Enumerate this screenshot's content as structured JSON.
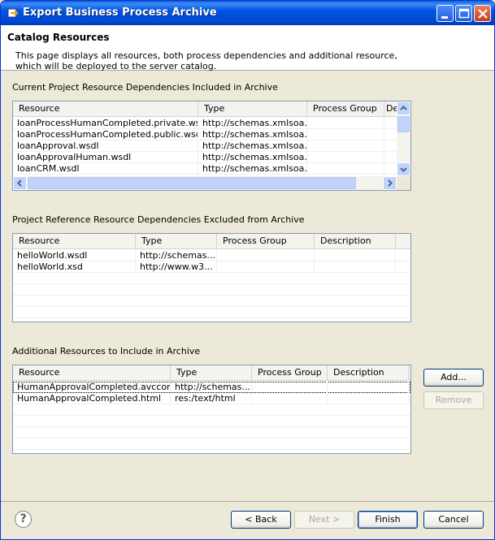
{
  "window": {
    "title": "Export Business Process Archive"
  },
  "header": {
    "title": "Catalog Resources",
    "description": "This page displays all resources, both process dependencies and additional resource, which will be deployed to the server catalog."
  },
  "sections": {
    "included_label": "Current Project Resource Dependencies Included in Archive",
    "excluded_label": "Project Reference Resource Dependencies Excluded from Archive",
    "additional_label": "Additional Resources to Include in Archive"
  },
  "included_table": {
    "columns": [
      "Resource",
      "Type",
      "Process Group",
      "Des"
    ],
    "rows": [
      [
        "loanProcessHumanCompleted.private.wsdl",
        "http://schemas.xmlsoa...",
        "",
        ""
      ],
      [
        "loanProcessHumanCompleted.public.wsdl",
        "http://schemas.xmlsoa...",
        "",
        ""
      ],
      [
        "loanApproval.wsdl",
        "http://schemas.xmlsoa...",
        "",
        ""
      ],
      [
        "loanApprovalHuman.wsdl",
        "http://schemas.xmlsoa...",
        "",
        ""
      ],
      [
        "loanCRM.wsdl",
        "http://schemas.xmlsoa...",
        "",
        ""
      ]
    ]
  },
  "excluded_table": {
    "columns": [
      "Resource",
      "Type",
      "Process Group",
      "Description"
    ],
    "rows": [
      [
        "helloWorld.wsdl",
        "http://schemas...",
        "",
        ""
      ],
      [
        "helloWorld.xsd",
        "http://www.w3...",
        "",
        ""
      ]
    ]
  },
  "additional_table": {
    "columns": [
      "Resource",
      "Type",
      "Process Group",
      "Description"
    ],
    "rows": [
      [
        "HumanApprovalCompleted.avcconfig",
        "http://schemas...",
        "",
        ""
      ],
      [
        "HumanApprovalCompleted.html",
        "res:/text/html",
        "",
        ""
      ]
    ]
  },
  "side_buttons": {
    "add": "Add...",
    "remove": "Remove"
  },
  "footer": {
    "help": "?",
    "back_label": "< Back",
    "next_label": "Next >",
    "finish_label": "Finish",
    "cancel_label": "Cancel"
  }
}
